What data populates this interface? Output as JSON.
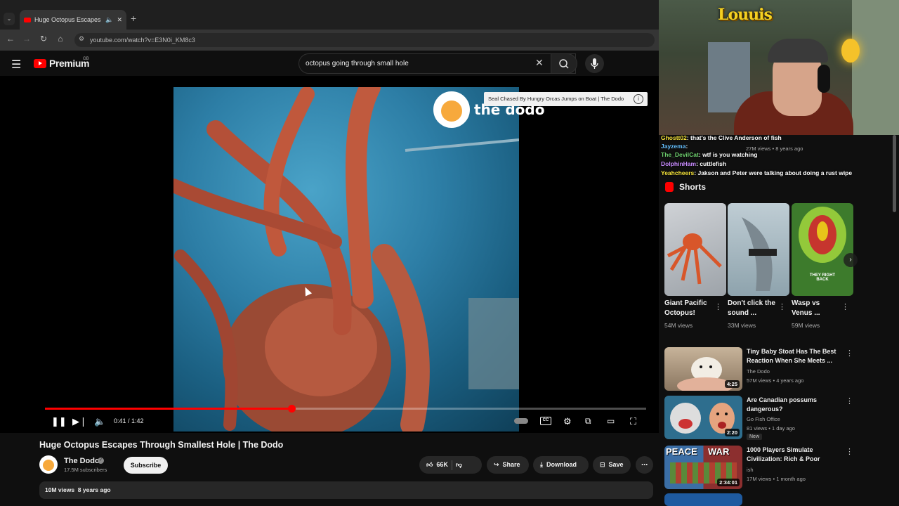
{
  "browser": {
    "tab_title": "Huge Octopus Escapes The",
    "new_tab": "+",
    "url": "youtube.com/watch?v=E3N0i_KM8c3"
  },
  "header": {
    "logo_text": "Premium",
    "region": "GB",
    "search_value": "octopus going through small hole"
  },
  "player": {
    "watermark": "the dodo",
    "endcard": "Seal Chased By Hungry Orcas Jumps on Boat | The Dodo",
    "time": "0:41 / 1:42",
    "progress": 0.41
  },
  "video": {
    "title": "Huge Octopus Escapes Through Smallest Hole | The Dodo",
    "channel": "The Dodo",
    "subscribers": "17.5M subscribers",
    "subscribe_label": "Subscribe",
    "likes": "66K",
    "share_label": "Share",
    "download_label": "Download",
    "save_label": "Save",
    "views": "10M views",
    "age": "8 years ago"
  },
  "stream": {
    "streamer": "Louuis"
  },
  "chat": [
    {
      "user": "Ghostt02",
      "color": "#f5e33a",
      "text": "that's the Clive Anderson of fish"
    },
    {
      "user": "Jayzema",
      "color": "#66c1ff",
      "text": ""
    },
    {
      "user": "The_DevilCat",
      "color": "#6fd16f",
      "text": "wtf is you watching"
    },
    {
      "user": "DolphinHam",
      "color": "#c98cff",
      "text": "cuttlefish"
    },
    {
      "user": "Yeahcheers",
      "color": "#f5e33a",
      "text": "Jakson and Peter were talking about doing a rust wipe"
    }
  ],
  "behind_chat_views": "27M views • 8 years ago",
  "shorts": {
    "heading": "Shorts",
    "items": [
      {
        "title": "Giant Pacific Octopus!",
        "views": "54M views"
      },
      {
        "title": "Don't click the sound ...",
        "views": "33M views"
      },
      {
        "title": "Wasp vs Venus ...",
        "views": "59M views",
        "overlay": "THEY RIGHT BACK"
      }
    ]
  },
  "recommendations": [
    {
      "title": "Tiny Baby Stoat Has The Best Reaction When She Meets ...",
      "channel": "The Dodo",
      "meta": "57M views • 4 years ago",
      "duration": "4:25"
    },
    {
      "title": "Are Canadian possums dangerous?",
      "channel": "Go Fish Office",
      "meta": "81 views • 1 day ago",
      "duration": "2:20",
      "badge": "New"
    },
    {
      "title": "1000 Players Simulate Civilization: Rich & Poor",
      "channel": "ish",
      "meta": "17M views • 1 month ago",
      "duration": "2:34:01",
      "thumb_left": "PEACE",
      "thumb_right": "WAR"
    }
  ],
  "colors": {
    "accent": "#ff0000",
    "background": "#0f0f0f"
  }
}
